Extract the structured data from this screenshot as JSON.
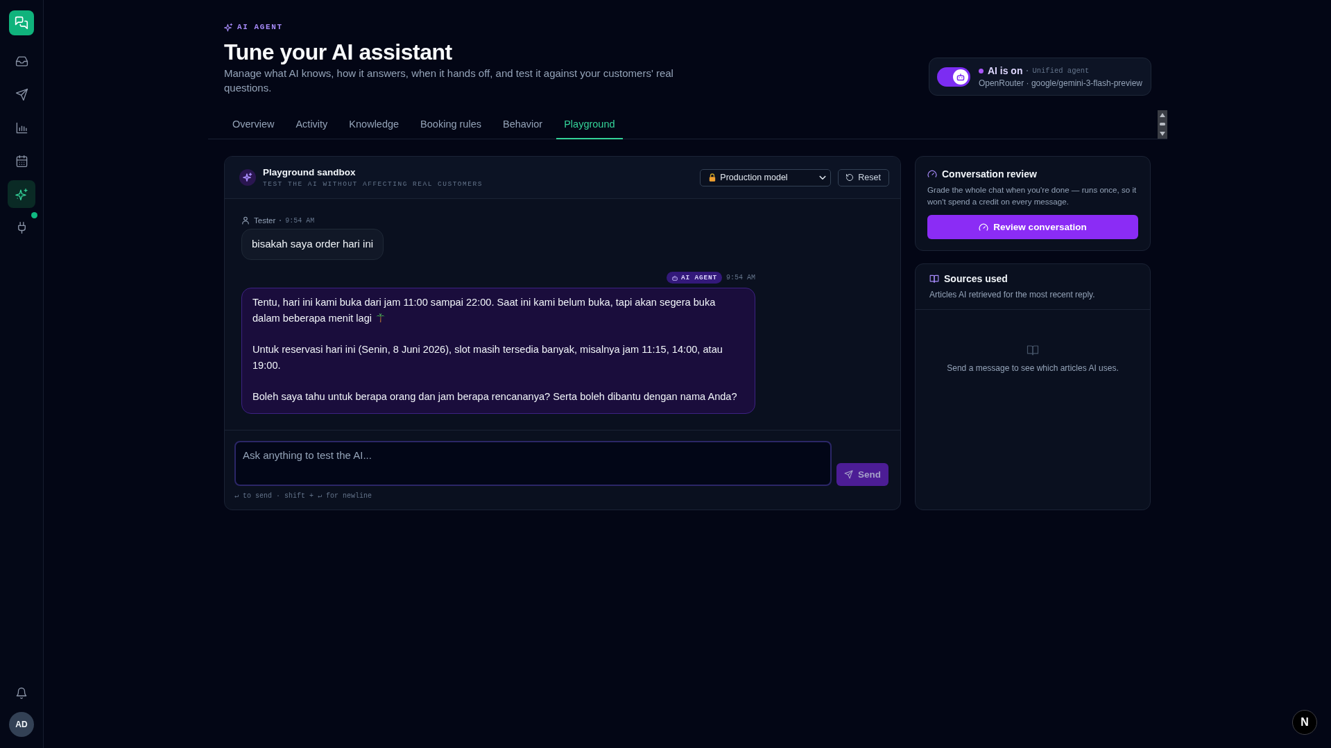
{
  "sidebar": {
    "items": [
      {
        "selected": false,
        "dot": false
      },
      {
        "selected": false,
        "dot": false
      },
      {
        "selected": false,
        "dot": false
      },
      {
        "selected": false,
        "dot": false
      },
      {
        "selected": true,
        "dot": false
      },
      {
        "selected": false,
        "dot": true
      }
    ],
    "avatar": {
      "initials": "AD"
    }
  },
  "header": {
    "eyebrow": "AI AGENT",
    "title": "Tune your AI assistant",
    "description": "Manage what AI knows, how it answers, when it hands off, and test it against your customers' real questions."
  },
  "ai_status": {
    "on": true,
    "label": "AI is on",
    "mode": "Unified agent",
    "details": "OpenRouter · google/gemini-3-flash-preview"
  },
  "tabs": [
    {
      "label": "Overview",
      "selected": false
    },
    {
      "label": "Activity",
      "selected": false
    },
    {
      "label": "Knowledge",
      "selected": false
    },
    {
      "label": "Booking rules",
      "selected": false
    },
    {
      "label": "Behavior",
      "selected": false
    },
    {
      "label": "Playground",
      "selected": true
    }
  ],
  "playground": {
    "title": "Playground sandbox",
    "subtitle": "TEST THE AI WITHOUT AFFECTING REAL CUSTOMERS",
    "model_select": {
      "value": "Production model"
    },
    "reset_label": "Reset",
    "messages": [
      {
        "kind": "user",
        "author": "Tester",
        "time": "9:54 AM",
        "text": "bisakah saya order hari ini"
      },
      {
        "kind": "agent",
        "badge": "AI AGENT",
        "time": "9:54 AM",
        "paragraphs": [
          {
            "text": "Tentu, hari ini kami buka dari jam 11:00 sampai 22:00. Saat ini kami belum buka, tapi akan segera buka dalam beberapa menit lagi",
            "icon_after": true
          },
          {
            "text": "Untuk reservasi hari ini (Senin, 8 Juni 2026), slot masih tersedia banyak, misalnya jam 11:15, 14:00, atau 19:00.",
            "icon_after": false
          },
          {
            "text": "Boleh saya tahu untuk berapa orang dan jam berapa rencananya? Serta boleh dibantu dengan nama Anda?",
            "icon_after": false
          }
        ]
      }
    ],
    "composer": {
      "placeholder": "Ask anything to test the AI...",
      "send_label": "Send",
      "send_disabled": true,
      "hint": "↵ to send · shift + ↵ for newline"
    }
  },
  "conversation_review": {
    "title": "Conversation review",
    "description": "Grade the whole chat when you're done — runs once, so it won't spend a credit on every message.",
    "button_label": "Review conversation"
  },
  "sources_used": {
    "title": "Sources used",
    "description": "Articles AI retrieved for the most recent reply.",
    "empty_text": "Send a message to see which articles AI uses."
  },
  "dev_badge": {
    "label": "N"
  }
}
